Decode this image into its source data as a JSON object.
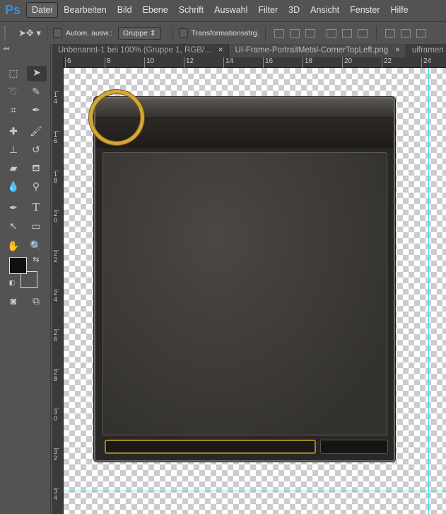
{
  "app": {
    "logo": "Ps"
  },
  "menu": [
    "Datei",
    "Bearbeiten",
    "Bild",
    "Ebene",
    "Schrift",
    "Auswahl",
    "Filter",
    "3D",
    "Ansicht",
    "Fenster",
    "Hilfe"
  ],
  "options": {
    "auto_select_label": "Autom. ausw.:",
    "auto_select_value": "Gruppe",
    "transform_label": "Transformationsstrg."
  },
  "tabs": [
    {
      "label": "Unbenannt-1 bei 100% (Gruppe 1, RGB/...",
      "close": "×"
    },
    {
      "label": "UI-Frame-PortraitMetal-CornerTopLeft.png",
      "close": "×"
    },
    {
      "label": "uiframen"
    }
  ],
  "rulers": {
    "horizontal": [
      "6",
      "8",
      "10",
      "12",
      "14",
      "16",
      "18",
      "20",
      "22",
      "24"
    ],
    "vertical": [
      "14",
      "16",
      "18",
      "20",
      "22",
      "24",
      "26",
      "28",
      "30",
      "32",
      "34"
    ]
  },
  "colors": {
    "foreground": "#12100e",
    "background": "#535353",
    "guide": "#30e0e8",
    "ring": "#d3a637"
  }
}
